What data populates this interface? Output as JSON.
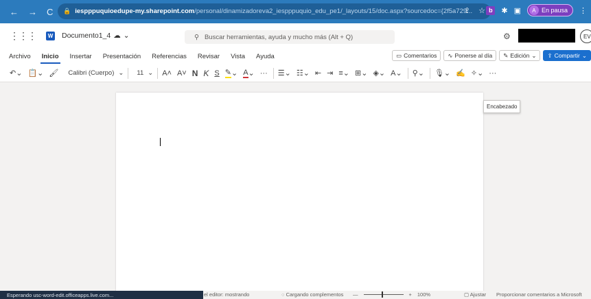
{
  "browser": {
    "back": "←",
    "forward": "→",
    "reload": "C",
    "url_host": "iespppuquioedupe-my.sharepoint.com",
    "url_path": "/personal/dinamizadoreva2_iespppuquio_edu_pe1/_layouts/15/doc.aspx?sourcedoc={2f5a729...",
    "profile_initial": "A",
    "profile_status": "En pausa"
  },
  "app": {
    "waffle": "⋮⋮⋮",
    "logo": "W",
    "doc_title": "Documento1_4",
    "search_placeholder": "Buscar herramientas, ayuda y mucho más (Alt + Q)",
    "user_initials": "EV"
  },
  "ribbon": {
    "tabs": [
      "Archivo",
      "Inicio",
      "Insertar",
      "Presentación",
      "Referencias",
      "Revisar",
      "Vista",
      "Ayuda"
    ],
    "comments": "Comentarios",
    "catch_up": "Ponerse al día",
    "editing": "Edición",
    "share": "Compartir"
  },
  "toolbar": {
    "font_name": "Calibri (Cuerpo)",
    "font_size": "11",
    "bold": "N",
    "italic": "K",
    "underline": "S"
  },
  "document": {
    "tooltip": "Encabezado"
  },
  "status": {
    "loading": "Esperando usc-word-edit.officeapps.live.com...",
    "editor": "el editor: mostrando",
    "addins": "Cargando complementos",
    "zoom": "100%",
    "fit": "Ajustar",
    "feedback": "Proporcionar comentarios a Microsoft"
  }
}
